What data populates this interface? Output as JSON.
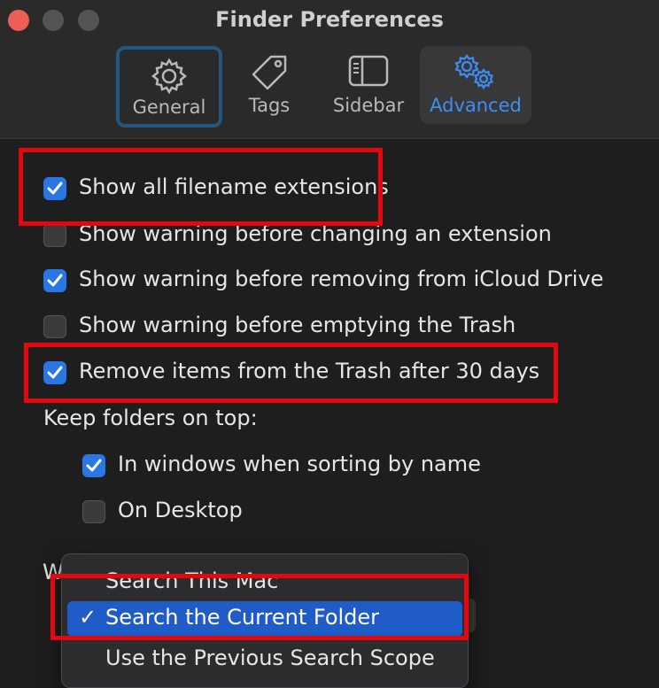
{
  "window": {
    "title": "Finder Preferences"
  },
  "tabs": [
    {
      "label": "General",
      "icon": "gear-icon"
    },
    {
      "label": "Tags",
      "icon": "tag-icon"
    },
    {
      "label": "Sidebar",
      "icon": "sidebar-icon"
    },
    {
      "label": "Advanced",
      "icon": "gears-icon",
      "selected": true
    }
  ],
  "options": [
    {
      "label": "Show all filename extensions",
      "checked": true
    },
    {
      "label": "Show warning before changing an extension",
      "checked": false
    },
    {
      "label": "Show warning before removing from iCloud Drive",
      "checked": true
    },
    {
      "label": "Show warning before emptying the Trash",
      "checked": false
    },
    {
      "label": "Remove items from the Trash after 30 days",
      "checked": true
    }
  ],
  "keep_folders": {
    "heading": "Keep folders on top:",
    "options": [
      {
        "label": "In windows when sorting by name",
        "checked": true
      },
      {
        "label": "On Desktop",
        "checked": false
      }
    ]
  },
  "search_scope": {
    "label_partial": "W",
    "menu_items": [
      {
        "label": "Search This Mac"
      },
      {
        "label": "Search the Current Folder",
        "selected": true,
        "check": "✓"
      },
      {
        "label": "Use the Previous Search Scope"
      }
    ]
  },
  "colors": {
    "accent": "#2a76e4",
    "selected_tab_text": "#3d8ef7",
    "highlight_box": "#e3080e",
    "menu_selection": "#1f5cc8"
  }
}
